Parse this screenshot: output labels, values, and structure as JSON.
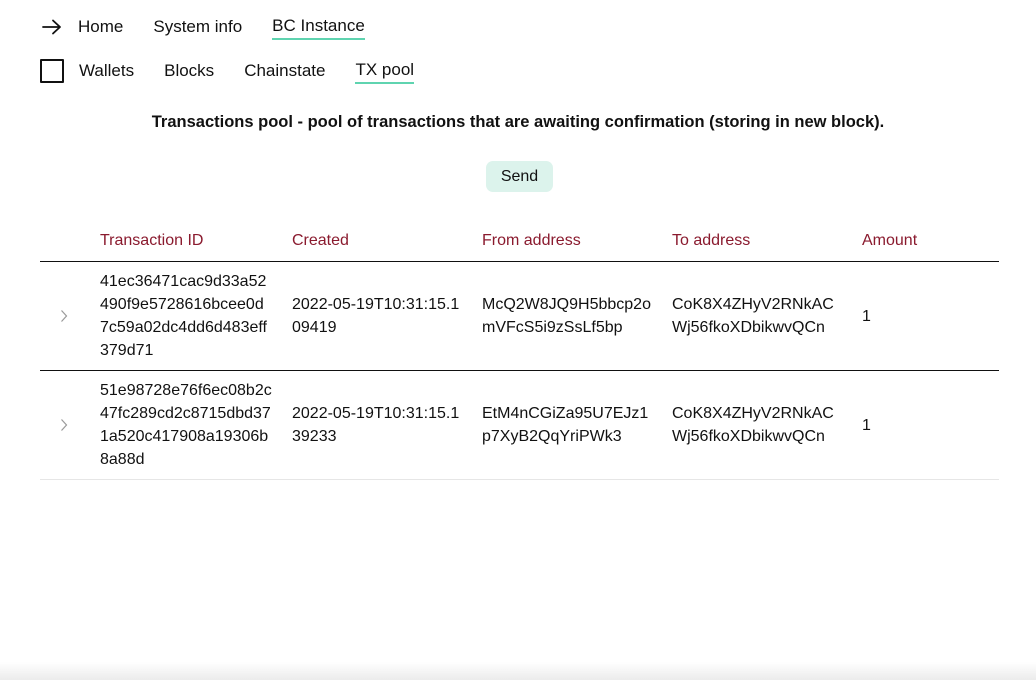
{
  "nav": {
    "top": [
      {
        "label": "Home",
        "active": false
      },
      {
        "label": "System info",
        "active": false
      },
      {
        "label": "BC Instance",
        "active": true
      }
    ],
    "sub": [
      {
        "label": "Wallets",
        "active": false
      },
      {
        "label": "Blocks",
        "active": false
      },
      {
        "label": "Chainstate",
        "active": false
      },
      {
        "label": "TX pool",
        "active": true
      }
    ]
  },
  "heading": "Transactions pool - pool of transactions that are awaiting confirmation (storing in new block).",
  "send_label": "Send",
  "table": {
    "columns": [
      "Transaction ID",
      "Created",
      "From address",
      "To address",
      "Amount"
    ],
    "rows": [
      {
        "id": "41ec36471cac9d33a52490f9e5728616bcee0d7c59a02dc4dd6d483eff379d71",
        "created": "2022-05-19T10:31:15.109419",
        "from": "McQ2W8JQ9H5bbcp2omVFcS5i9zSsLf5bp",
        "to": "CoK8X4ZHyV2RNkACWj56fkoXDbikwvQCn",
        "amount": "1"
      },
      {
        "id": "51e98728e76f6ec08b2c47fc289cd2c8715dbd371a520c417908a19306b8a88d",
        "created": "2022-05-19T10:31:15.139233",
        "from": "EtM4nCGiZa95U7EJz1p7XyB2QqYriPWk3",
        "to": "CoK8X4ZHyV2RNkACWj56fkoXDbikwvQCn",
        "amount": "1"
      }
    ]
  },
  "colors": {
    "accent_underline": "#5fd4b0",
    "header_text": "#8a1a2e",
    "button_bg": "#dcf3ec"
  },
  "icons": {
    "top_nav": "arrow-right-icon",
    "sub_nav": "checkbox-icon",
    "row_expand": "chevron-right-icon"
  }
}
